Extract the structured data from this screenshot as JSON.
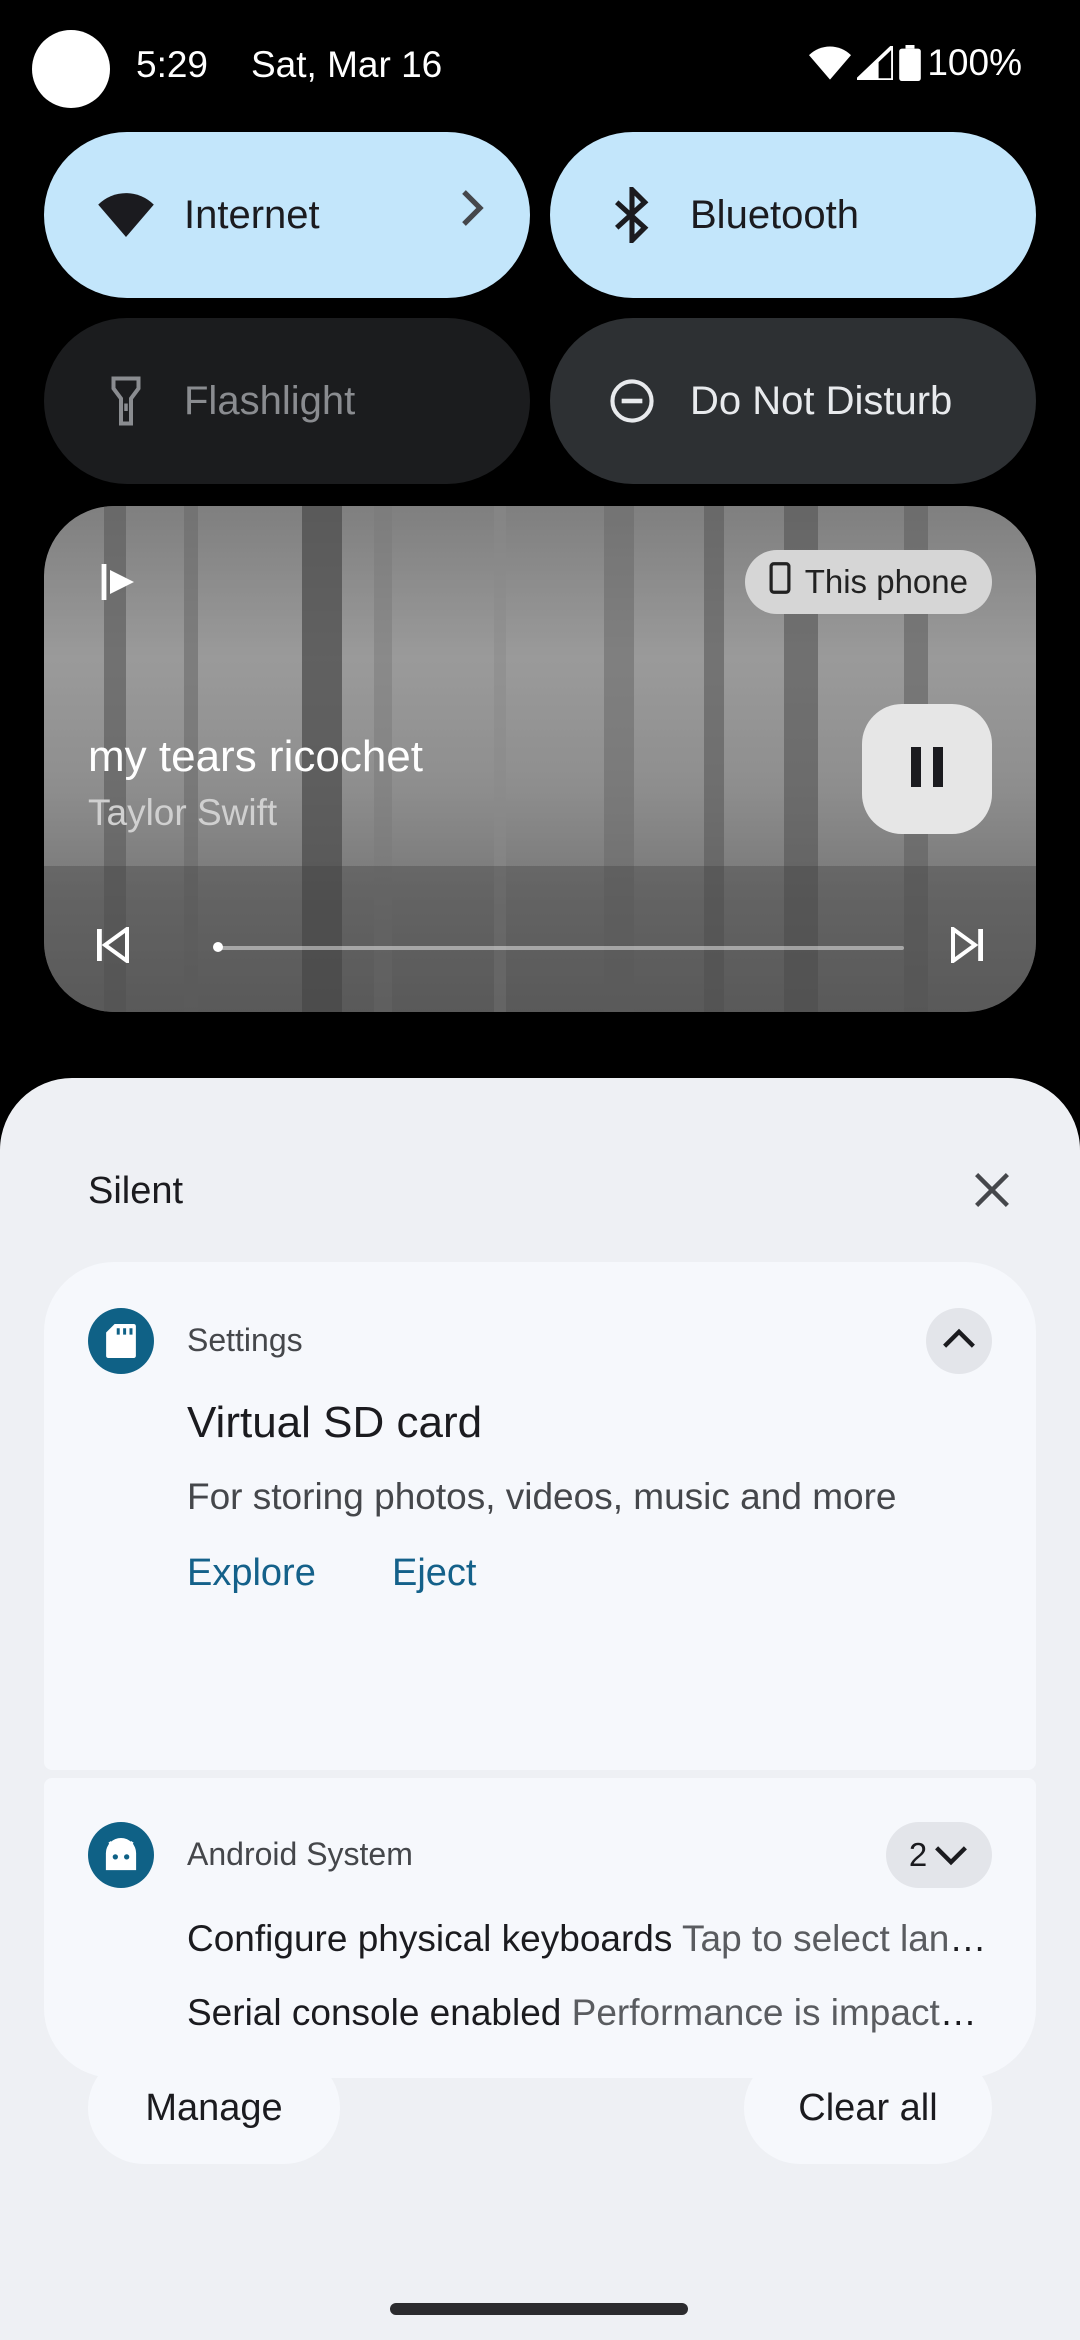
{
  "status_bar": {
    "time": "5:29",
    "date": "Sat, Mar 16",
    "battery": "100%",
    "icons": [
      "wifi-icon",
      "cell-signal-icon",
      "battery-icon"
    ]
  },
  "quick_tiles": [
    {
      "label": "Internet",
      "icon": "wifi-icon",
      "state": "on"
    },
    {
      "label": "Bluetooth",
      "icon": "bluetooth-icon",
      "state": "on"
    },
    {
      "label": "Flashlight",
      "icon": "flashlight-icon",
      "state": "unavailable"
    },
    {
      "label": "Do Not Disturb",
      "icon": "dnd-icon",
      "state": "off"
    }
  ],
  "media": {
    "device": "This phone",
    "song": "my tears ricochet",
    "artist": "Taylor Swift",
    "progress": 0.0
  },
  "notifications": {
    "section_title": "Silent",
    "items": [
      {
        "app": "Settings",
        "title": "Virtual SD card",
        "body": "For storing photos, videos, music and more",
        "actions": [
          "Explore",
          "Eject"
        ]
      },
      {
        "app": "Android System",
        "count": "2",
        "rows": [
          {
            "title": "Configure physical keyboards",
            "text": "Tap to select language and layout"
          },
          {
            "title": "Serial console enabled",
            "text": "Performance is impacted. To disable, check bootloader."
          }
        ]
      }
    ],
    "manage_label": "Manage",
    "clear_all_label": "Clear all"
  },
  "colors": {
    "tile_on": "#c3e6fb",
    "accent": "#14618a",
    "sheet_bg": "#eef0f4"
  }
}
